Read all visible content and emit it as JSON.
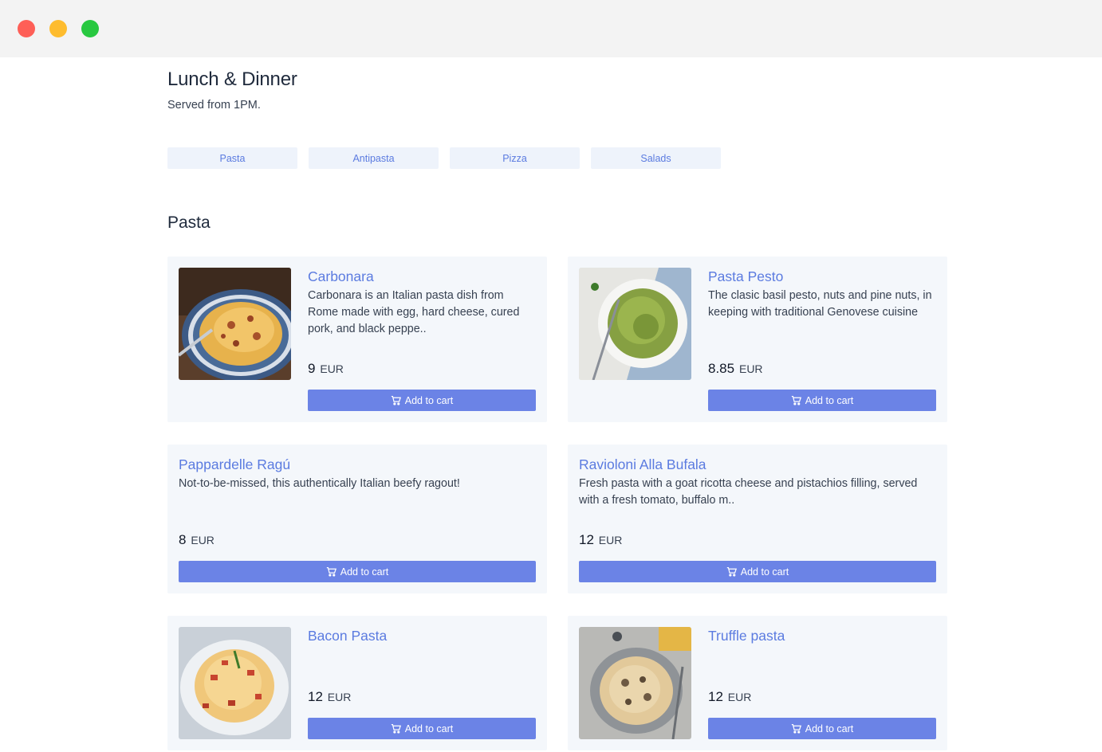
{
  "page": {
    "title": "Lunch & Dinner",
    "subtitle": "Served from 1PM."
  },
  "tabs": [
    "Pasta",
    "Antipasta",
    "Pizza",
    "Salads"
  ],
  "section": {
    "title": "Pasta"
  },
  "currency": "EUR",
  "add_to_cart_label": "Add to cart",
  "colors": {
    "accent": "#6b83e6",
    "link": "#5b7be0",
    "card_bg": "#f4f7fb",
    "tab_bg": "#eef3fb"
  },
  "items": [
    {
      "name": "Carbonara",
      "description": "Carbonara is an Italian pasta dish from Rome made with egg, hard cheese, cured pork, and black peppe..",
      "price": "9",
      "image": "carbonara-photo"
    },
    {
      "name": "Pasta Pesto",
      "description": "The clasic basil pesto, nuts and pine nuts, in keeping with traditional Genovese cuisine",
      "price": "8.85",
      "image": "pesto-photo"
    },
    {
      "name": "Pappardelle Ragú",
      "description": "Not-to-be-missed, this authentically Italian beefy ragout!",
      "price": "8",
      "image": ""
    },
    {
      "name": "Ravioloni Alla Bufala",
      "description": "Fresh pasta with a goat ricotta cheese and pistachios filling, served with a fresh tomato, buffalo m..",
      "price": "12",
      "image": ""
    },
    {
      "name": "Bacon Pasta",
      "description": "",
      "price": "12",
      "image": "bacon-pasta-photo"
    },
    {
      "name": "Truffle pasta",
      "description": "",
      "price": "12",
      "image": "truffle-pasta-photo"
    }
  ]
}
